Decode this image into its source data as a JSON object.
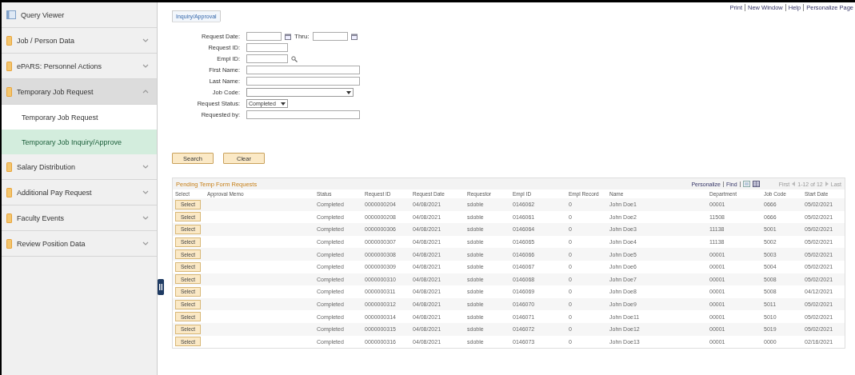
{
  "sidebar": {
    "items": [
      {
        "label": "Query Viewer",
        "kind": "page"
      },
      {
        "label": "Job / Person Data",
        "kind": "folder",
        "expanded": false
      },
      {
        "label": "ePARS: Personnel Actions",
        "kind": "folder",
        "expanded": false
      },
      {
        "label": "Temporary Job Request",
        "kind": "folder",
        "expanded": true,
        "children": [
          {
            "label": "Temporary Job Request",
            "selected": false
          },
          {
            "label": "Temporary Job Inquiry/Approve",
            "selected": true
          }
        ]
      },
      {
        "label": "Salary Distribution",
        "kind": "folder",
        "expanded": false
      },
      {
        "label": "Additional Pay Request",
        "kind": "folder",
        "expanded": false
      },
      {
        "label": "Faculty Events",
        "kind": "folder",
        "expanded": false
      },
      {
        "label": "Review Position Data",
        "kind": "folder",
        "expanded": false
      }
    ]
  },
  "header_links": [
    "Print",
    "New Window",
    "Help",
    "Personalize Page"
  ],
  "tabs": [
    {
      "label": "Inquiry/Approval",
      "selected": true
    }
  ],
  "form": {
    "fields": [
      {
        "label": "Request Date:",
        "kind": "date",
        "second_label": "Thru:"
      },
      {
        "label": "Request ID:",
        "kind": "short"
      },
      {
        "label": "Empl ID:",
        "kind": "lookup"
      },
      {
        "label": "First Name:",
        "kind": "text"
      },
      {
        "label": "Last Name:",
        "kind": "text"
      },
      {
        "label": "Job Code:",
        "kind": "dropdown"
      },
      {
        "label": "Request Status:",
        "kind": "select",
        "value": "Completed"
      },
      {
        "label": "Requested by:",
        "kind": "text"
      }
    ],
    "buttons": [
      "Search",
      "Clear"
    ]
  },
  "grid": {
    "title": "Pending Temp Form Requests",
    "nav_left": [
      "Personalize",
      "Find"
    ],
    "nav_right": {
      "first": "First",
      "range": "1-12 of 12",
      "last": "Last"
    },
    "columns": [
      "Select",
      "Approval Memo",
      "Status",
      "Request ID",
      "Request Date",
      "Requestor",
      "Empl ID",
      "Empl Record",
      "Name",
      "Department",
      "Job Code",
      "Start Date"
    ],
    "rows": [
      {
        "cells": [
          "Select",
          "",
          "Completed",
          "0000000204",
          "04/08/2021",
          "sdoble",
          "0146062",
          "0",
          "John Doe1",
          "00001",
          "0666",
          "05/02/2021"
        ]
      },
      {
        "cells": [
          "Select",
          "",
          "Completed",
          "0000000208",
          "04/08/2021",
          "sdoble",
          "0146061",
          "0",
          "John Doe2",
          "11508",
          "0666",
          "05/02/2021"
        ]
      },
      {
        "cells": [
          "Select",
          "",
          "Completed",
          "0000000306",
          "04/08/2021",
          "sdoble",
          "0146064",
          "0",
          "John Doe3",
          "11138",
          "5001",
          "05/02/2021"
        ]
      },
      {
        "cells": [
          "Select",
          "",
          "Completed",
          "0000000307",
          "04/08/2021",
          "sdoble",
          "0146065",
          "0",
          "John Doe4",
          "11138",
          "5002",
          "05/02/2021"
        ]
      },
      {
        "cells": [
          "Select",
          "",
          "Completed",
          "0000000308",
          "04/08/2021",
          "sdoble",
          "0146066",
          "0",
          "John Doe5",
          "00001",
          "5003",
          "05/02/2021"
        ]
      },
      {
        "cells": [
          "Select",
          "",
          "Completed",
          "0000000309",
          "04/08/2021",
          "sdoble",
          "0146067",
          "0",
          "John Doe6",
          "00001",
          "5004",
          "05/02/2021"
        ]
      },
      {
        "cells": [
          "Select",
          "",
          "Completed",
          "0000000310",
          "04/08/2021",
          "sdoble",
          "0146068",
          "0",
          "John Doe7",
          "00001",
          "5008",
          "05/02/2021"
        ]
      },
      {
        "cells": [
          "Select",
          "",
          "Completed",
          "0000000311",
          "04/08/2021",
          "sdoble",
          "0146069",
          "0",
          "John Doe8",
          "00001",
          "5008",
          "04/12/2021"
        ]
      },
      {
        "cells": [
          "Select",
          "",
          "Completed",
          "0000000312",
          "04/08/2021",
          "sdoble",
          "0146070",
          "0",
          "John Doe9",
          "00001",
          "5011",
          "05/02/2021"
        ]
      },
      {
        "cells": [
          "Select",
          "",
          "Completed",
          "0000000314",
          "04/08/2021",
          "sdoble",
          "0146071",
          "0",
          "John Doe11",
          "00001",
          "5010",
          "05/02/2021"
        ]
      },
      {
        "cells": [
          "Select",
          "",
          "Completed",
          "0000000315",
          "04/08/2021",
          "sdoble",
          "0146072",
          "0",
          "John Doe12",
          "00001",
          "5019",
          "05/02/2021"
        ]
      },
      {
        "cells": [
          "Select",
          "",
          "Completed",
          "0000000316",
          "04/08/2021",
          "sdoble",
          "0146073",
          "0",
          "John Doe13",
          "00001",
          "0000",
          "02/16/2021"
        ]
      }
    ]
  }
}
